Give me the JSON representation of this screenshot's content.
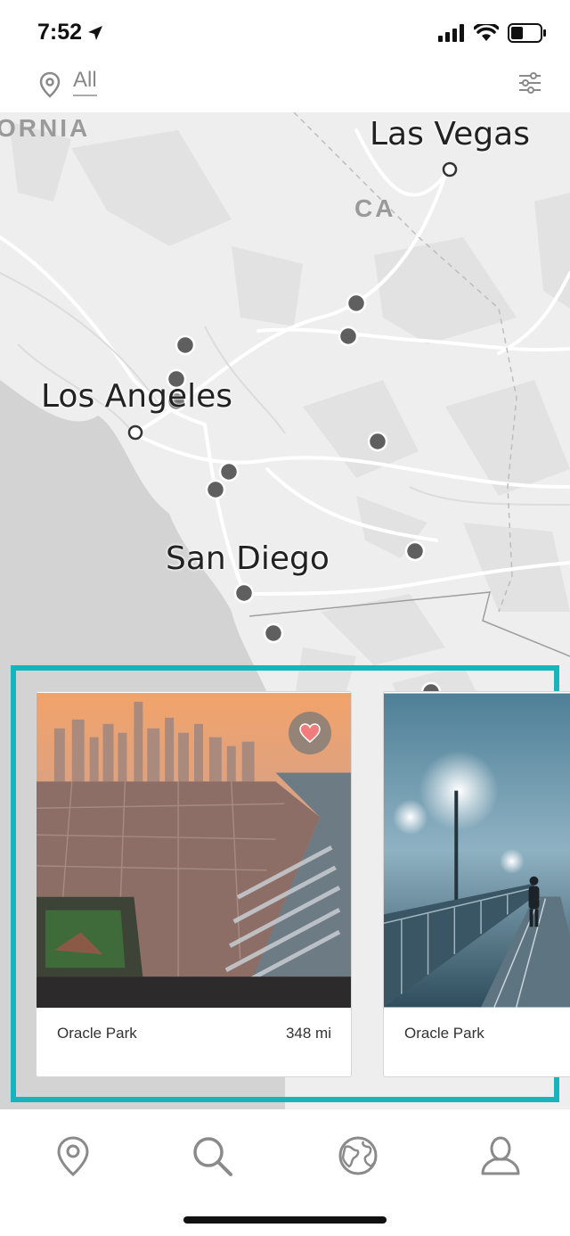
{
  "status_bar": {
    "time": "7:52",
    "icons": [
      "location-arrow-icon",
      "cellular-signal-icon",
      "wifi-icon",
      "battery-icon"
    ]
  },
  "filter_bar": {
    "location_filter": "All",
    "icons": [
      "location-pin-icon",
      "settings-sliders-icon"
    ]
  },
  "map": {
    "region_labels": [
      "ORNIA",
      "CA"
    ],
    "cities": [
      {
        "name": "Las Vegas"
      },
      {
        "name": "Los Angeles"
      },
      {
        "name": "San Diego"
      }
    ]
  },
  "cards": [
    {
      "name": "Oracle Park",
      "distance": "348 mi",
      "favorited": true
    },
    {
      "name": "Oracle Park",
      "distance": "",
      "favorited": false
    }
  ],
  "tabs": [
    {
      "name": "map",
      "icon": "location-pin-icon"
    },
    {
      "name": "search",
      "icon": "search-icon"
    },
    {
      "name": "explore",
      "icon": "globe-icon"
    },
    {
      "name": "profile",
      "icon": "user-icon"
    }
  ],
  "colors": {
    "accent": "#16b4be",
    "map_background": "#ececec",
    "water": "#d4d4d4",
    "marker": "#5f5f5f",
    "favorite_heart": "#f07c7c"
  }
}
